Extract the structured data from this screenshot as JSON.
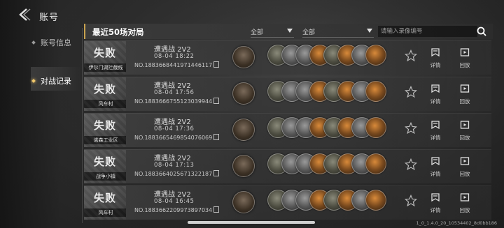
{
  "header": {
    "title": "账号"
  },
  "sidebar": {
    "items": [
      {
        "label": "账号信息",
        "active": false
      },
      {
        "label": "对战记录",
        "active": true
      }
    ]
  },
  "list_header": {
    "title": "最近50场对局",
    "filter1": "全部",
    "filter2": "全部",
    "search_placeholder": "请输入录像编号"
  },
  "actions": {
    "detail_label": "详情",
    "replay_label": "回放"
  },
  "matches": [
    {
      "result": "失败",
      "map": "伊尔门湖拦截线",
      "mode": "遭遇战 2V2",
      "time": "08-04 18:22",
      "replay_no": "NO.1883668441971446117"
    },
    {
      "result": "失败",
      "map": "风车村",
      "mode": "遭遇战 2V2",
      "time": "08-04 17:56",
      "replay_no": "NO.1883666755123039944"
    },
    {
      "result": "失败",
      "map": "诺森工业区",
      "mode": "遭遇战 2V2",
      "time": "08-04 17:36",
      "replay_no": "NO.1883665469854076069"
    },
    {
      "result": "失败",
      "map": "战争小镇",
      "mode": "遭遇战 2V2",
      "time": "08-04 17:13",
      "replay_no": "NO.1883664025671322187"
    },
    {
      "result": "失败",
      "map": "风车村",
      "mode": "遭遇战 2V2",
      "time": "08-04 16:45",
      "replay_no": "NO.1883662209973897034"
    }
  ],
  "footer": {
    "version": "1_0_1.4.0_20_10534402_8d0bb186"
  },
  "colors": {
    "accent": "#c9a24e",
    "active_dot": "#f2c86a"
  }
}
